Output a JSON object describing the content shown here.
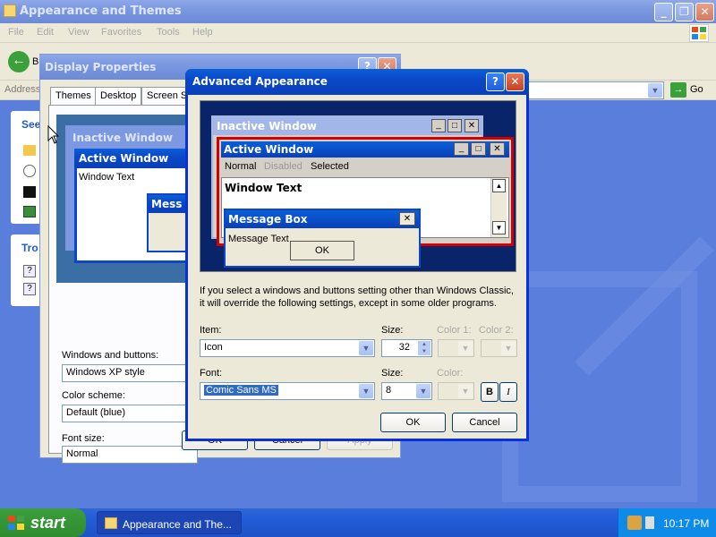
{
  "explorer": {
    "title": "Appearance and Themes",
    "menu": [
      "File",
      "Edit",
      "View",
      "Favorites",
      "Tools",
      "Help"
    ],
    "back_label": "B",
    "address_label": "Address",
    "go_label": "Go",
    "see_also": "See",
    "troubleshoot": "Tro"
  },
  "display_properties": {
    "title": "Display Properties",
    "tabs": [
      "Themes",
      "Desktop",
      "Screen S"
    ],
    "preview": {
      "inactive_title": "Inactive Window",
      "active_title": "Active Window",
      "window_text": "Window Text",
      "message_title": "Mess"
    },
    "windows_buttons_label": "Windows and buttons:",
    "windows_buttons_value": "Windows XP style",
    "color_scheme_label": "Color scheme:",
    "color_scheme_value": "Default (blue)",
    "font_size_label": "Font size:",
    "font_size_value": "Normal",
    "ok_label": "OK",
    "cancel_label": "Cancel",
    "apply_label": "Apply"
  },
  "advanced_appearance": {
    "title": "Advanced Appearance",
    "preview": {
      "inactive_title": "Inactive Window",
      "active_title": "Active Window",
      "menu_normal": "Normal",
      "menu_disabled": "Disabled",
      "menu_selected": "Selected",
      "window_text": "Window Text",
      "message_title": "Message Box",
      "message_text": "Message Text",
      "message_ok": "OK"
    },
    "info_line1": "If you select a windows and buttons setting other than Windows Classic,",
    "info_line2": "it will override the following settings, except in some older programs.",
    "item_label": "Item:",
    "item_value": "Icon",
    "size_label": "Size:",
    "size_value": "32",
    "color1_label": "Color 1:",
    "color2_label": "Color 2:",
    "font_label": "Font:",
    "font_value": "Comic Sans MS",
    "font_size_label": "Size:",
    "font_size_value": "8",
    "color_label": "Color:",
    "bold_label": "B",
    "italic_label": "I",
    "ok_label": "OK",
    "cancel_label": "Cancel"
  },
  "taskbar": {
    "start_label": "start",
    "task_label": "Appearance and The...",
    "clock": "10:17 PM"
  },
  "colors": {
    "xp_blue": "#0a48c8",
    "active_red_highlight": "#d40000",
    "preview_navy": "#0a246a",
    "start_green": "#2f8b2f"
  }
}
